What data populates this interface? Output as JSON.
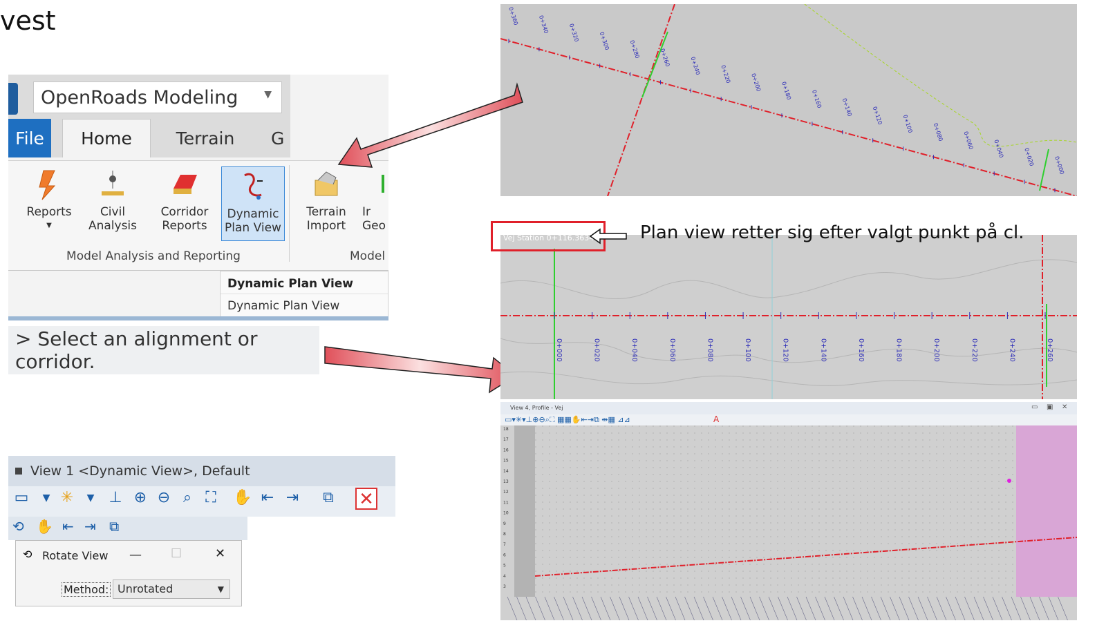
{
  "slide": {
    "title_fragment": "vest"
  },
  "workspace": {
    "selector_value": "OpenRoads Modeling"
  },
  "ribbon": {
    "tabs": [
      "File",
      "Home",
      "Terrain",
      "G"
    ],
    "buttons": {
      "reports": "Reports",
      "civil_analysis": "Civil\nAnalysis",
      "corridor_reports": "Corridor\nReports",
      "dynamic_plan_view": "Dynamic\nPlan View",
      "terrain_import": "Terrain\nImport",
      "next_partial": "Ir\nGeo"
    },
    "group_labels": [
      "Model Analysis and Reporting",
      "Model"
    ],
    "tooltip": {
      "title": "Dynamic Plan View",
      "body": "Dynamic Plan View"
    }
  },
  "prompt": {
    "text": "> Select an alignment or corridor."
  },
  "view_window": {
    "title": "View 1 <Dynamic View>, Default"
  },
  "rotate_dialog": {
    "title": "Rotate View",
    "method_label": "Method:",
    "method_value": "Unrotated"
  },
  "plan_view": {
    "caption": "Plan view retter sig efter valgt punkt på cl.",
    "station_readout": "Vej Station 0+116.3634",
    "top_stations": [
      "0+360",
      "0+340",
      "0+320",
      "0+300",
      "0+280",
      "0+260",
      "0+240",
      "0+220",
      "0+200",
      "0+180",
      "0+160",
      "0+140",
      "0+120",
      "0+100",
      "0+080",
      "0+060",
      "0+040",
      "0+020",
      "0+000"
    ],
    "dynamic_stations": [
      "0+000",
      "0+020",
      "0+040",
      "0+060",
      "0+080",
      "0+100",
      "0+120",
      "0+140",
      "0+160",
      "0+180",
      "0+200",
      "0+220",
      "0+240",
      "0+260"
    ]
  },
  "profile_view": {
    "title": "View 4, Profile - Vej",
    "y_ticks": [
      "18",
      "17",
      "16",
      "15",
      "14",
      "13",
      "12",
      "11",
      "10",
      "9",
      "8",
      "7",
      "6",
      "5",
      "4",
      "3"
    ]
  },
  "colors": {
    "arrow_fill": "#f2b1b1",
    "alignment_red": "#e0202a",
    "station_blue": "#2d2db8",
    "station_green": "#2fcf2f",
    "highlight_pink": "#d9a6d6"
  }
}
